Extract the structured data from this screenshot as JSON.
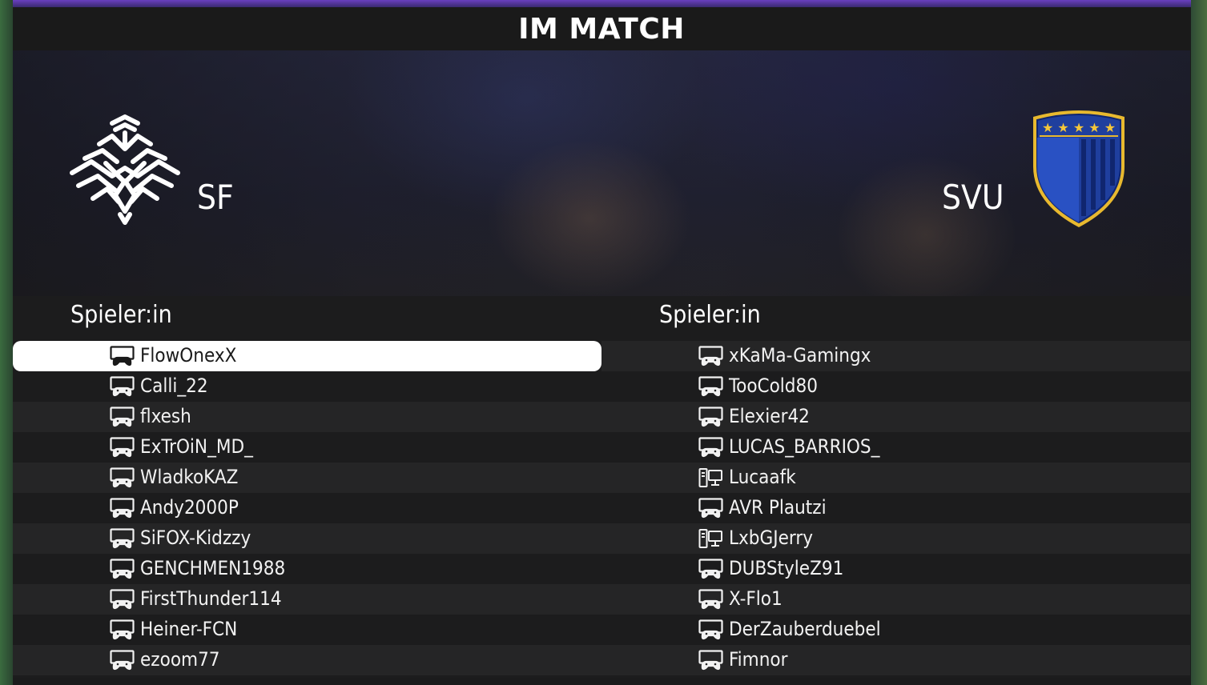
{
  "header": {
    "title": "IM MATCH"
  },
  "teams": {
    "left": {
      "name": "SF",
      "crest_icon": "white-stylized-bird-crest-icon"
    },
    "right": {
      "name": "SVU",
      "crest_icon": "blue-shield-five-stars-crest-icon",
      "crest_colors": [
        "#1f3f9e",
        "#e8b92f"
      ]
    }
  },
  "lists": {
    "left": {
      "header": "Spieler:in",
      "players": [
        {
          "name": "FlowOnexX",
          "platform": "console"
        },
        {
          "name": "Calli_22",
          "platform": "console"
        },
        {
          "name": "flxesh",
          "platform": "console"
        },
        {
          "name": "ExTrOiN_MD_",
          "platform": "console"
        },
        {
          "name": "WladkoKAZ",
          "platform": "console"
        },
        {
          "name": "Andy2000P",
          "platform": "console"
        },
        {
          "name": "SiFOX-Kidzzy",
          "platform": "console"
        },
        {
          "name": "GENCHMEN1988",
          "platform": "console"
        },
        {
          "name": "FirstThunder114",
          "platform": "console"
        },
        {
          "name": "Heiner-FCN",
          "platform": "console"
        },
        {
          "name": "ezoom77",
          "platform": "console"
        }
      ]
    },
    "right": {
      "header": "Spieler:in",
      "players": [
        {
          "name": "xKaMa-Gamingx",
          "platform": "console"
        },
        {
          "name": "TooCold80",
          "platform": "console"
        },
        {
          "name": "Elexier42",
          "platform": "console"
        },
        {
          "name": "LUCAS_BARRIOS_",
          "platform": "console"
        },
        {
          "name": "Lucaafk",
          "platform": "pc"
        },
        {
          "name": "AVR Plautzi",
          "platform": "console"
        },
        {
          "name": "LxbGJerry",
          "platform": "pc"
        },
        {
          "name": "DUBStyleZ91",
          "platform": "console"
        },
        {
          "name": "X-Flo1",
          "platform": "console"
        },
        {
          "name": "DerZauberduebel",
          "platform": "console"
        },
        {
          "name": "Fimnor",
          "platform": "console"
        }
      ]
    }
  },
  "selected": {
    "list": "left",
    "index": 0
  }
}
